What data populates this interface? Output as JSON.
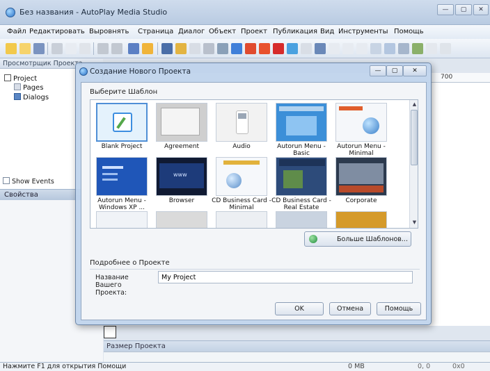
{
  "window": {
    "title": "Без названия - AutoPlay Media Studio",
    "minimize": "—",
    "maximize": "▢",
    "close": "✕"
  },
  "menu": [
    "Файл",
    "Редактировать",
    "Выровнять",
    "Страница",
    "Диалог",
    "Объект",
    "Проект",
    "Публикация",
    "Вид",
    "Инструменты",
    "Помощь"
  ],
  "project_browser": {
    "header": "Просмотрщик Проекта",
    "root": "Project",
    "items": [
      "Pages",
      "Dialogs"
    ],
    "show_events": "Show Events"
  },
  "properties": {
    "header": "Свойства"
  },
  "canvas": {
    "ruler_value": "700",
    "size_panel": "Размер Проекта"
  },
  "statusbar": {
    "text": "Нажмите F1 для открытия Помощи",
    "memory": "0 MB",
    "position": "0, 0",
    "size": "0x0"
  },
  "dialog": {
    "title": "Создание Нового Проекта",
    "choose_label": "Выберите Шаблон",
    "templates": [
      {
        "label": "Blank Project",
        "icon": "blank-project-icon",
        "color": "#dff0fb"
      },
      {
        "label": "Agreement",
        "icon": "agreement-icon",
        "color": "#d8d8d8"
      },
      {
        "label": "Audio",
        "icon": "audio-icon",
        "color": "#eeeeee"
      },
      {
        "label": "Autorun Menu - Basic",
        "icon": "autorun-basic-icon",
        "color": "#3c8fd8"
      },
      {
        "label": "Autorun Menu - Minimal",
        "icon": "autorun-minimal-icon",
        "color": "#f2f5f8"
      },
      {
        "label": "Autorun Menu - Windows XP ...",
        "icon": "autorun-xp-icon",
        "color": "#1f56b8"
      },
      {
        "label": "Browser",
        "icon": "browser-icon",
        "color": "#111a33"
      },
      {
        "label": "CD Business Card - Minimal",
        "icon": "cd-minimal-icon",
        "color": "#f4f7fb"
      },
      {
        "label": "CD Business Card - Real Estate",
        "icon": "cd-realestate-icon",
        "color": "#2d4b7a"
      },
      {
        "label": "Corporate",
        "icon": "corporate-icon",
        "color": "#2c3a4e"
      }
    ],
    "more_templates": "Больше Шаблонов...",
    "details_label": "Подробнее о Проекте",
    "name_label": "Название Вашего Проекта:",
    "name_value": "My Project",
    "ok": "OK",
    "cancel": "Отмена",
    "help": "Помощь"
  }
}
